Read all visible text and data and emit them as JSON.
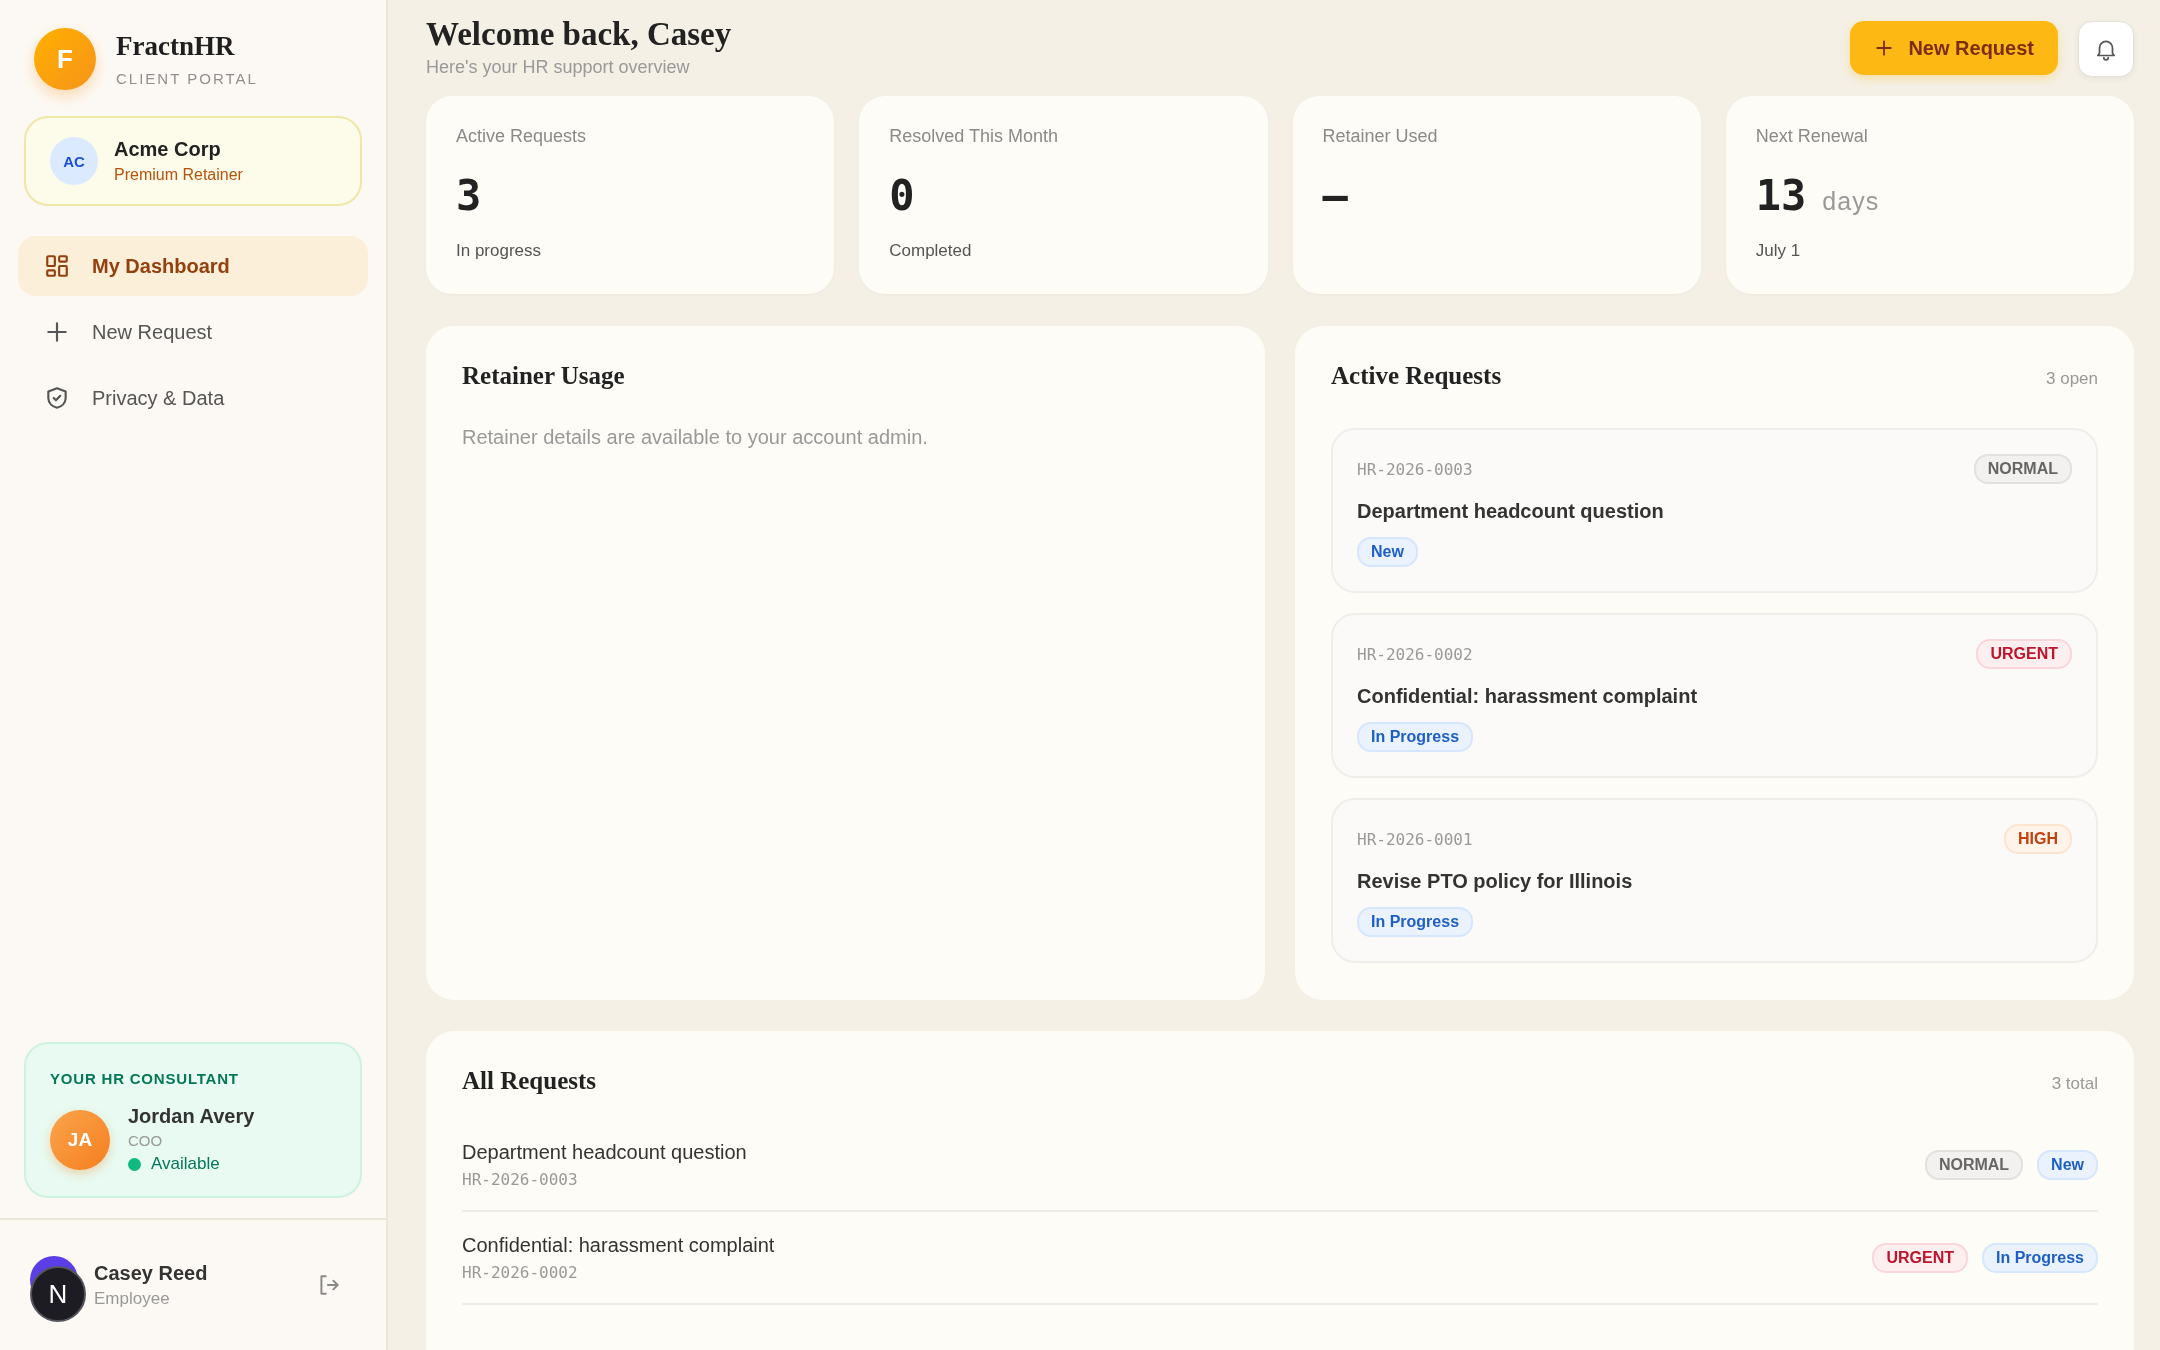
{
  "sidebar": {
    "brand": {
      "logo_letter": "F",
      "name": "FractnHR",
      "tagline": "CLIENT PORTAL"
    },
    "account": {
      "initials": "AC",
      "name": "Acme Corp",
      "plan": "Premium Retainer"
    },
    "nav": [
      {
        "label": "My Dashboard",
        "kind": "dashboard",
        "selected": true
      },
      {
        "label": "New Request",
        "kind": "create",
        "selected": false
      },
      {
        "label": "Privacy & Data",
        "kind": "privacy",
        "selected": false
      }
    ],
    "consultant": {
      "heading": "YOUR HR CONSULTANT",
      "initials": "JA",
      "name": "Jordan Avery",
      "role": "COO",
      "status": "Available",
      "online": true
    },
    "user": {
      "name": "Casey Reed",
      "role": "Employee",
      "dev_badge": "N"
    }
  },
  "header": {
    "title": "Welcome back, Casey",
    "subtitle": "Here's your HR support overview",
    "primary_button": "New Request"
  },
  "stats": [
    {
      "label": "Active Requests",
      "value": "3",
      "sub": "In progress"
    },
    {
      "label": "Resolved This Month",
      "value": "0",
      "sub": "Completed"
    },
    {
      "label": "Retainer Used",
      "value": "–"
    },
    {
      "label": "Next Renewal",
      "value": "13",
      "unit": "days",
      "sub": "July 1"
    }
  ],
  "retainer_usage": {
    "title": "Retainer Usage",
    "message": "Retainer details are available to your account admin."
  },
  "active_requests": {
    "title": "Active Requests",
    "count": "3 open",
    "items": [
      {
        "id": "HR-2026-0003",
        "title": "Department headcount question",
        "priority": {
          "text": "NORMAL",
          "kind": "normal"
        },
        "status": "New"
      },
      {
        "id": "HR-2026-0002",
        "title": "Confidential: harassment complaint",
        "priority": {
          "text": "URGENT",
          "kind": "urgent"
        },
        "status": "In Progress"
      },
      {
        "id": "HR-2026-0001",
        "title": "Revise PTO policy for Illinois",
        "priority": {
          "text": "HIGH",
          "kind": "high"
        },
        "status": "In Progress"
      }
    ]
  },
  "all_requests": {
    "title": "All Requests",
    "count": "3 total",
    "rows": [
      {
        "title": "Department headcount question",
        "id": "HR-2026-0003",
        "priority": {
          "text": "NORMAL",
          "kind": "normal"
        },
        "status": "New"
      },
      {
        "title": "Confidential: harassment complaint",
        "id": "HR-2026-0002",
        "priority": {
          "text": "URGENT",
          "kind": "urgent"
        },
        "status": "In Progress"
      }
    ]
  }
}
